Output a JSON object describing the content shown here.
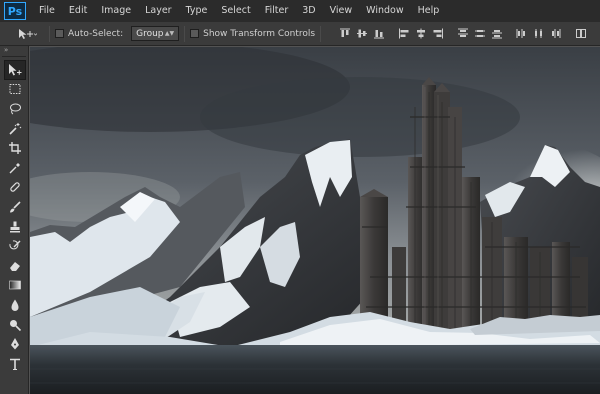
{
  "app": {
    "logo_text": "Ps",
    "accent": "#31a8ff"
  },
  "menu": {
    "items": [
      "File",
      "Edit",
      "Image",
      "Layer",
      "Type",
      "Select",
      "Filter",
      "3D",
      "View",
      "Window",
      "Help"
    ]
  },
  "options": {
    "tool_icon": "move-tool-icon",
    "auto_select_label": "Auto-Select:",
    "auto_select_checked": false,
    "auto_select_value": "Group",
    "show_transform_label": "Show Transform Controls",
    "show_transform_checked": false,
    "align_icons": [
      "align-top-edges-icon",
      "align-vertical-centers-icon",
      "align-bottom-edges-icon",
      "align-left-edges-icon",
      "align-horizontal-centers-icon",
      "align-right-edges-icon",
      "distribute-top-icon",
      "distribute-vertical-centers-icon",
      "distribute-bottom-icon",
      "distribute-left-icon",
      "distribute-horizontal-centers-icon",
      "distribute-right-icon",
      "auto-align-layers-icon"
    ]
  },
  "tools": {
    "panel_collapse_glyph": "»",
    "items": [
      "move-tool-icon",
      "rectangular-marquee-icon",
      "lasso-icon",
      "quick-selection-icon",
      "crop-icon",
      "eyedropper-icon",
      "spot-healing-brush-icon",
      "brush-icon",
      "clone-stamp-icon",
      "history-brush-icon",
      "eraser-icon",
      "gradient-icon",
      "blur-icon",
      "dodge-icon",
      "pen-icon",
      "type-icon"
    ],
    "active_index": 0
  },
  "document": {
    "content_description_name": "canvas-image"
  }
}
